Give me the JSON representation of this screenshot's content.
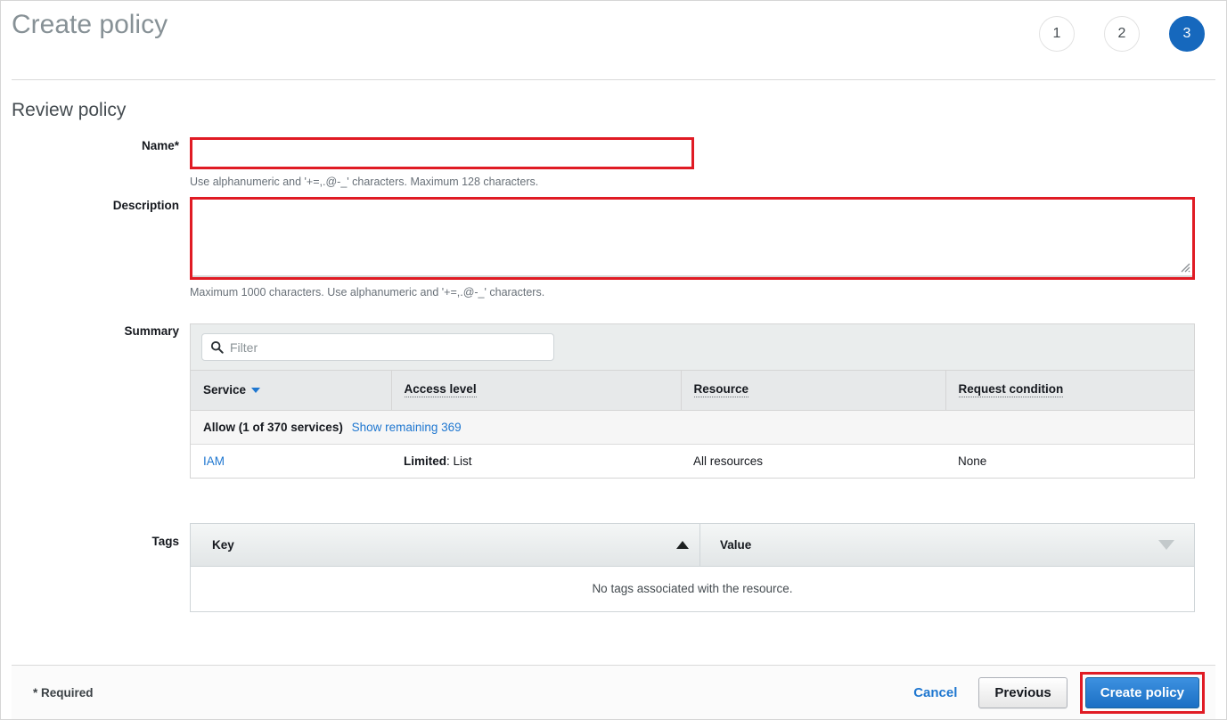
{
  "header": {
    "title": "Create policy",
    "steps": [
      {
        "label": "1",
        "active": false
      },
      {
        "label": "2",
        "active": false
      },
      {
        "label": "3",
        "active": true
      }
    ],
    "active_step_color": "#1668bd"
  },
  "section": {
    "title": "Review policy"
  },
  "form": {
    "name": {
      "label": "Name*",
      "value": "",
      "placeholder": "",
      "hint": "Use alphanumeric and '+=,.@-_' characters. Maximum 128 characters.",
      "highlight_color": "#e01b24"
    },
    "description": {
      "label": "Description",
      "value": "",
      "placeholder": "",
      "hint": "Maximum 1000 characters. Use alphanumeric and '+=,.@-_' characters.",
      "highlight_color": "#e01b24"
    }
  },
  "summary": {
    "label": "Summary",
    "filter": {
      "value": "",
      "placeholder": "Filter",
      "icon": "search-icon"
    },
    "columns": [
      {
        "label": "Service",
        "sort": "descending",
        "icon": "caret-down-icon",
        "dotted": false
      },
      {
        "label": "Access level",
        "dotted": true
      },
      {
        "label": "Resource",
        "dotted": true
      },
      {
        "label": "Request condition",
        "dotted": true
      }
    ],
    "group_row": {
      "label": "Allow (1 of 370 services)",
      "link": "Show remaining 369"
    },
    "rows": [
      {
        "service": "IAM",
        "access_level_prefix": "Limited",
        "access_level_value": ": List",
        "resource": "All resources",
        "request_condition": "None"
      }
    ],
    "link_color": "#1f77d0"
  },
  "tags": {
    "label": "Tags",
    "columns": [
      {
        "label": "Key",
        "sort": "ascending",
        "icon": "caret-up-icon"
      },
      {
        "label": "Value",
        "sort": "none",
        "icon": "caret-down-icon"
      }
    ],
    "empty_message": "No tags associated with the resource."
  },
  "footer": {
    "required_note": "* Required",
    "cancel_label": "Cancel",
    "previous_label": "Previous",
    "create_label": "Create policy",
    "create_highlight_color": "#e01b24"
  }
}
